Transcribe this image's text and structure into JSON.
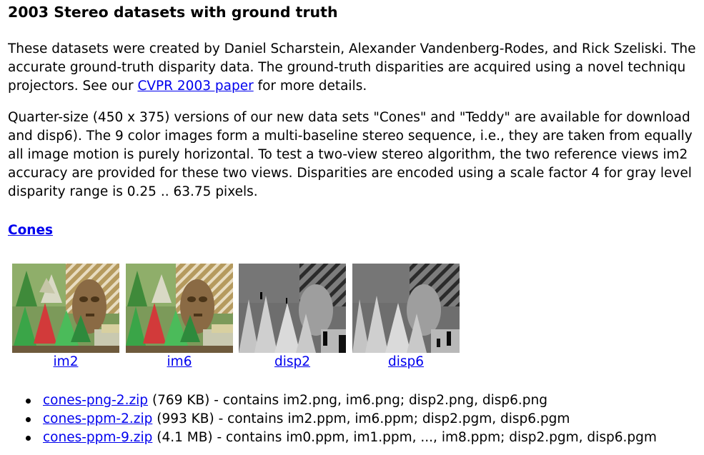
{
  "page": {
    "title": "2003 Stereo datasets with ground truth"
  },
  "intro": {
    "line1": "These datasets were created by Daniel Scharstein, Alexander Vandenberg-Rodes, and Rick Szeliski. The",
    "line2": "accurate ground-truth disparity data. The ground-truth disparities are acquired using a novel techniqu",
    "line3_before": "projectors. See our ",
    "line3_link": "CVPR 2003 paper",
    "line3_after": " for more details."
  },
  "quarter": {
    "line1": "Quarter-size (450 x 375) versions of our new data sets \"Cones\" and \"Teddy\" are available for download",
    "line2": "and disp6). The 9 color images form a multi-baseline stereo sequence, i.e., they are taken from equally",
    "line3": "all image motion is purely horizontal. To test a two-view stereo algorithm, the two reference views im2",
    "line4": "accuracy are provided for these two views. Disparities are encoded using a scale factor 4 for gray level",
    "line5": "disparity range is 0.25 .. 63.75 pixels."
  },
  "cones": {
    "heading": "Cones",
    "thumbnails": [
      {
        "caption": "im2",
        "kind": "color-photo"
      },
      {
        "caption": "im6",
        "kind": "color-photo"
      },
      {
        "caption": "disp2",
        "kind": "disparity-map"
      },
      {
        "caption": "disp6",
        "kind": "disparity-map"
      }
    ],
    "files": [
      {
        "link": "cones-png-2.zip",
        "size": "(769 KB)",
        "desc": " - contains im2.png, im6.png; disp2.png, disp6.png"
      },
      {
        "link": "cones-ppm-2.zip",
        "size": "(993 KB)",
        "desc": " - contains im2.ppm, im6.ppm; disp2.pgm, disp6.pgm"
      },
      {
        "link": "cones-ppm-9.zip",
        "size": "(4.1 MB)",
        "desc": " - contains im0.ppm, im1.ppm, ..., im8.ppm; disp2.pgm, disp6.pgm"
      }
    ]
  },
  "colors": {
    "link": "#0000ee",
    "text": "#000000"
  }
}
